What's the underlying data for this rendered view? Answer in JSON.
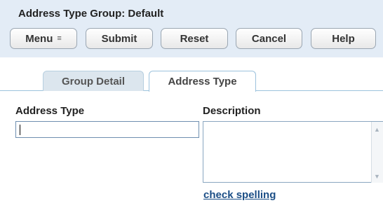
{
  "header": {
    "title": "Address Type Group: Default"
  },
  "toolbar": {
    "menu_label": "Menu",
    "menu_glyph": "≡",
    "submit_label": "Submit",
    "reset_label": "Reset",
    "cancel_label": "Cancel",
    "help_label": "Help"
  },
  "tabs": [
    {
      "label": "Group Detail",
      "active": false
    },
    {
      "label": "Address Type",
      "active": true
    }
  ],
  "form": {
    "address_type_label": "Address Type",
    "address_type_value": "",
    "description_label": "Description",
    "description_value": "",
    "check_spelling_link": "check spelling"
  },
  "scrollbar": {
    "up_icon": "chevron-up",
    "down_icon": "chevron-down"
  }
}
